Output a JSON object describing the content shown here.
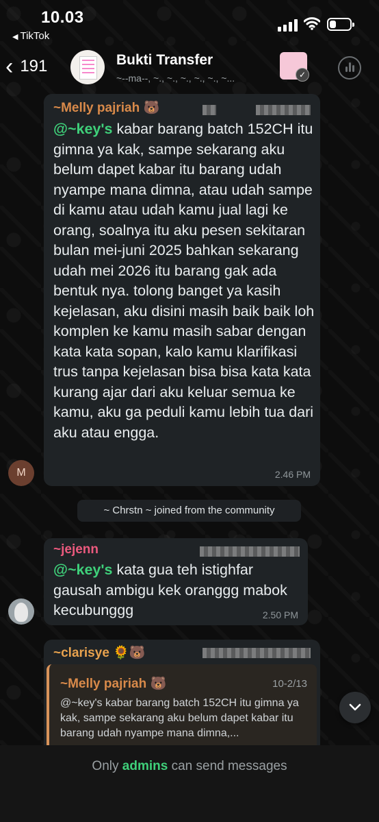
{
  "status_bar": {
    "time": "10.03",
    "back_app": "TikTok"
  },
  "header": {
    "back_count": "191",
    "group_name": "Bukti Transfer",
    "members": "~--ma--, ~., ~., ~., ~., ~., ~..."
  },
  "messages": [
    {
      "sender": "~Melly pajriah 🐻",
      "mention": "@~key's",
      "text": " kabar barang batch 152CH itu gimna ya kak, sampe sekarang aku belum dapet kabar itu barang udah nyampe mana dimna, atau udah sampe di kamu atau udah kamu jual lagi ke orang, soalnya itu aku pesen sekitaran bulan mei-juni 2025 bahkan sekarang udah mei 2026 itu barang gak ada bentuk nya. tolong banget ya kasih kejelasan, aku disini masih baik baik loh komplen ke kamu masih sabar dengan kata kata sopan, kalo kamu klarifikasi trus tanpa kejelasan bisa bisa kata kata kurang ajar dari aku keluar semua ke kamu, aku ga peduli kamu lebih tua dari aku atau engga.",
      "time": "2.46 PM",
      "avatar_initial": "M"
    },
    {
      "sender": "~jejenn",
      "mention": "@~key's",
      "text": " kata gua teh istighfar gausah ambigu kek oranggg mabok kecubunggg",
      "time": "2.50 PM"
    },
    {
      "sender": "~clarisye 🌻🐻",
      "quote": {
        "sender": "~Melly pajriah 🐻",
        "date": "10-2/13",
        "text": "@~key's kabar barang batch 152CH itu gimna ya kak, sampe sekarang aku belum dapet kabar itu barang udah nyampe mana dimna,..."
      }
    }
  ],
  "system_message": "~ Chrstn ~ joined from the community",
  "footer": {
    "prefix": "Only ",
    "admins": "admins",
    "suffix": " can send messages"
  },
  "colors": {
    "mention": "#3fd07a",
    "sender_melly": "#d98a4a",
    "sender_jejenn": "#ec5a7e",
    "sender_clarisye": "#e8a24e",
    "bubble": "#1f2326"
  },
  "icons": [
    "back-chevron-icon",
    "audio-call-icon",
    "scroll-down-icon",
    "signal-icon",
    "wifi-icon",
    "battery-icon"
  ]
}
